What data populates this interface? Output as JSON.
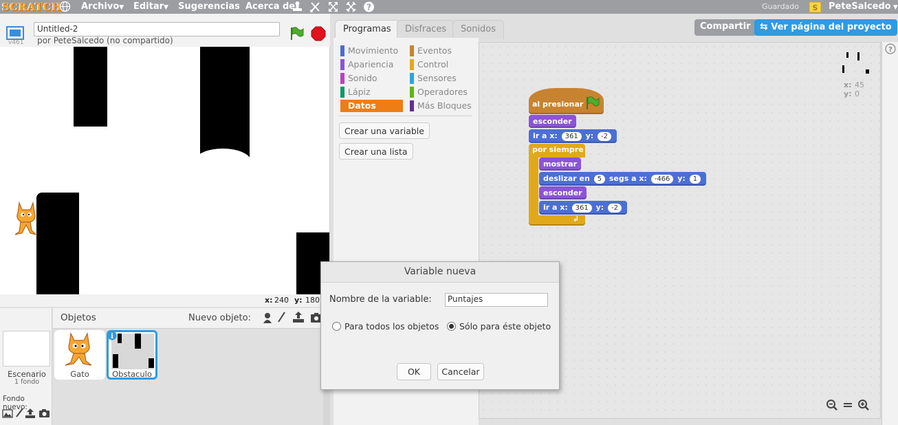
{
  "menubar": {
    "logo": "SCRATCH",
    "items": [
      "Archivo",
      "Editar",
      "Sugerencias",
      "Acerca de"
    ],
    "saved_status": "Guardado",
    "username": "PeteSalcedo"
  },
  "project": {
    "title": "Untitled-2",
    "author": "por PeteSalcedo (no compartido)",
    "version": "v461"
  },
  "stage": {
    "coord_x_label": "x:",
    "coord_x_value": "240",
    "coord_y_label": "y:",
    "coord_y_value": "180"
  },
  "sprites": {
    "header": "Objetos",
    "new_object_label": "Nuevo objeto:",
    "stage_label": "Escenario",
    "stage_backdrops": "1 fondo",
    "new_backdrop_label": "Fondo nuevo:",
    "list": [
      {
        "name": "Gato",
        "selected": false
      },
      {
        "name": "Obstaculo",
        "selected": true
      }
    ]
  },
  "tabs": [
    "Programas",
    "Disfraces",
    "Sonidos"
  ],
  "active_tab": "Programas",
  "categories": {
    "left": [
      {
        "label": "Movimiento",
        "color": "#4a6cd4"
      },
      {
        "label": "Apariencia",
        "color": "#8a55d7"
      },
      {
        "label": "Sonido",
        "color": "#bb42c3"
      },
      {
        "label": "Lápiz",
        "color": "#0e9a6c"
      },
      {
        "label": "Datos",
        "color": "#ee7d16"
      }
    ],
    "right": [
      {
        "label": "Eventos",
        "color": "#c88330"
      },
      {
        "label": "Control",
        "color": "#e1a91a"
      },
      {
        "label": "Sensores",
        "color": "#2ca5e2"
      },
      {
        "label": "Operadores",
        "color": "#5cb712"
      },
      {
        "label": "Más Bloques",
        "color": "#632d99"
      }
    ],
    "selected": "Datos"
  },
  "palette_buttons": {
    "make_variable": "Crear una variable",
    "make_list": "Crear una lista"
  },
  "top_buttons": {
    "share": "Compartir",
    "see_page": "Ver página del proyecto"
  },
  "script": {
    "hat": "al presionar",
    "hide1": "esconder",
    "goto1": {
      "text": "ir a x:",
      "x": "361",
      "ylabel": "y:",
      "y": "-2"
    },
    "forever": "por siempre",
    "show": "mostrar",
    "glide": {
      "text": "deslizar en",
      "secs": "5",
      "mid": "segs a x:",
      "x": "-466",
      "ylabel": "y:",
      "y": "1"
    },
    "hide2": "esconder",
    "goto2": {
      "text": "ir a x:",
      "x": "361",
      "ylabel": "y:",
      "y": "-2"
    }
  },
  "sprite_info": {
    "x_label": "x:",
    "x_value": "45",
    "y_label": "y:",
    "y_value": "0"
  },
  "dialog": {
    "title": "Variable nueva",
    "name_label": "Nombre de la variable:",
    "name_value": "Puntajes",
    "option_all": "Para todos los objetos",
    "option_this": "Sólo para éste objeto",
    "selected_option": "this",
    "ok": "OK",
    "cancel": "Cancelar"
  }
}
